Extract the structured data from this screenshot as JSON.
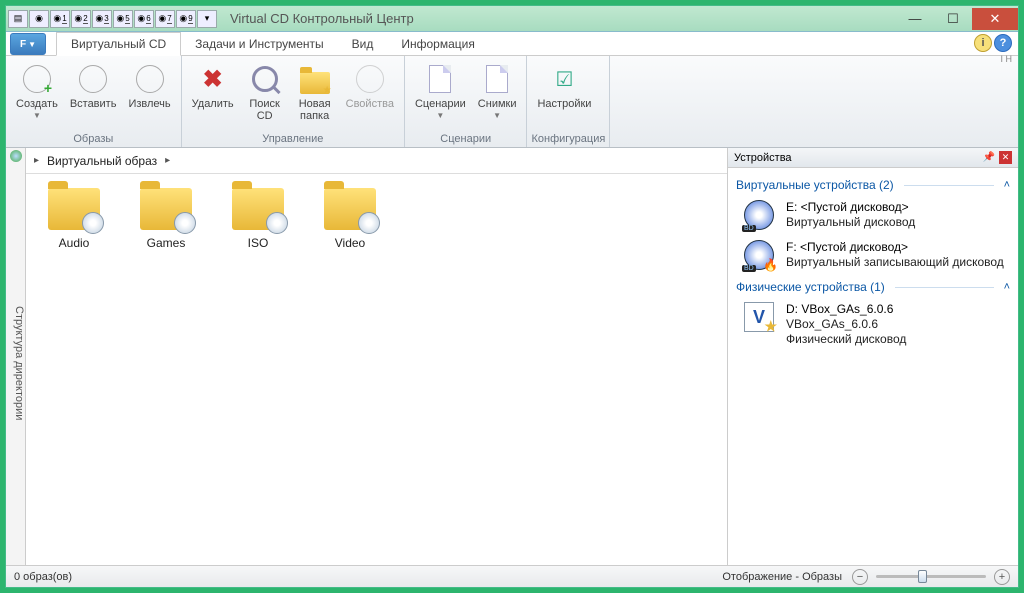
{
  "title": "Virtual CD Контрольный Центр",
  "qa_numbers": [
    "1",
    "2",
    "3",
    "5",
    "6",
    "7",
    "9"
  ],
  "file_button": "F",
  "tabs": {
    "virtual_cd": "Виртуальный CD",
    "tasks": "Задачи и Инструменты",
    "view": "Вид",
    "info": "Информация"
  },
  "ribbon_right_labels": "I   H",
  "ribbon": {
    "images": {
      "create": "Создать",
      "insert": "Вставить",
      "eject": "Извлечь",
      "group": "Образы"
    },
    "manage": {
      "delete": "Удалить",
      "search": "Поиск\nCD",
      "newfolder": "Новая\nпапка",
      "props": "Свойства",
      "group": "Управление"
    },
    "scenarios": {
      "scen": "Сценарии",
      "snaps": "Снимки",
      "group": "Сценарии"
    },
    "config": {
      "settings": "Настройки",
      "group": "Конфигурация"
    }
  },
  "sidebar_tab": "Структура директории",
  "breadcrumb": {
    "root": "Виртуальный образ"
  },
  "folders": [
    {
      "name": "Audio"
    },
    {
      "name": "Games"
    },
    {
      "name": "ISO"
    },
    {
      "name": "Video"
    }
  ],
  "devices": {
    "header": "Устройства",
    "virtual_title": "Виртуальные устройства (2)",
    "physical_title": "Физические устройства (1)",
    "virtual": [
      {
        "line1": "E: <Пустой дисковод>",
        "line2": "Виртуальный дисковод",
        "burn": false
      },
      {
        "line1": "F: <Пустой дисковод>",
        "line2": "Виртуальный записывающий дисковод",
        "burn": true
      }
    ],
    "physical": [
      {
        "line1": "D: VBox_GAs_6.0.6",
        "line2": "VBox_GAs_6.0.6",
        "line3": "Физический дисковод"
      }
    ]
  },
  "status": {
    "left": "0 образ(ов)",
    "right": "Отображение - Образы"
  }
}
